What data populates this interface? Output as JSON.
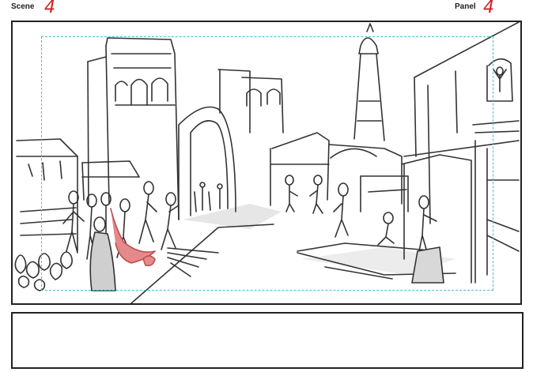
{
  "header": {
    "scene_label": "Scene",
    "scene_number": "4",
    "panel_label": "Panel",
    "panel_number": "4"
  },
  "colors": {
    "number_red": "#d11f25",
    "safe_area_guide": "#4fb8d6",
    "sketch_line": "#333333",
    "cloak_fill": "#e58a8a",
    "shadow_fill": "#c8c8c8"
  },
  "notes": {
    "text": ""
  }
}
